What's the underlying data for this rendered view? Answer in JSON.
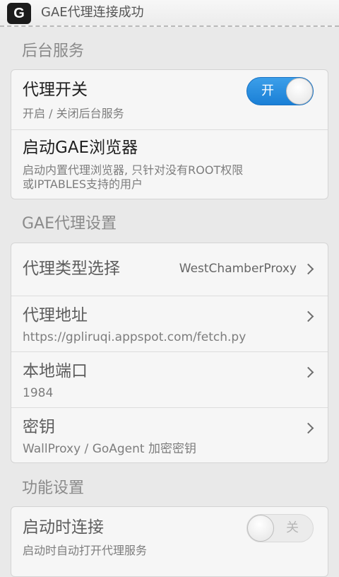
{
  "statusbar": {
    "app_icon_letter": "G",
    "notification_text": "GAE代理连接成功"
  },
  "sections": {
    "background": {
      "header": "后台服务",
      "proxy_switch": {
        "title": "代理开关",
        "subtitle": "开启 / 关闭后台服务",
        "toggle_label": "开",
        "toggle_state": "on"
      },
      "browser": {
        "title": "启动GAE浏览器",
        "subtitle_line1": "启动内置代理浏览器, 只针对没有ROOT权限",
        "subtitle_line2": "或IPTABLES支持的用户"
      }
    },
    "gae": {
      "header": "GAE代理设置",
      "proxy_type": {
        "title": "代理类型选择",
        "value": "WestChamberProxy"
      },
      "proxy_address": {
        "title": "代理地址",
        "subtitle": "https://gpliruqi.appspot.com/fetch.py"
      },
      "local_port": {
        "title": "本地端口",
        "subtitle": "1984"
      },
      "secret_key": {
        "title": "密钥",
        "subtitle": "WallProxy / GoAgent 加密密钥"
      }
    },
    "features": {
      "header": "功能设置",
      "connect_on_start": {
        "title": "启动时连接",
        "subtitle": "启动时自动打开代理服务",
        "toggle_label": "关",
        "toggle_state": "off"
      }
    }
  },
  "colors": {
    "accent": "#1f84da",
    "background": "#e9e9e9",
    "card": "#f6f6f6"
  }
}
